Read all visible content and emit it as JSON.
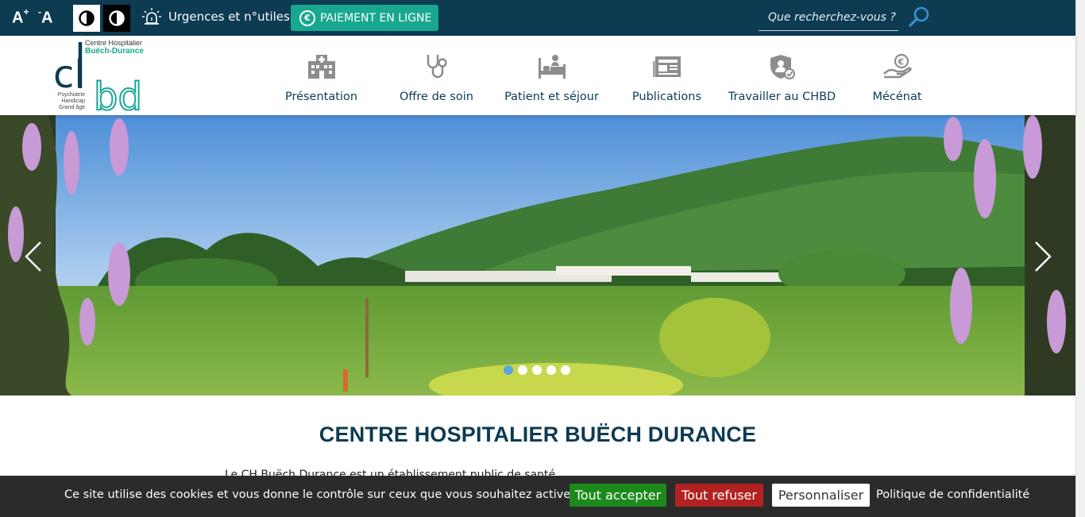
{
  "topbar": {
    "font_increase": "A",
    "font_increase_sup": "+",
    "font_decrease": "A",
    "font_decrease_sup": "-",
    "urgences_label": "Urgences et n°utiles",
    "pay_label": "PAIEMENT EN LIGNE",
    "pay_icon_glyph": "€",
    "search_placeholder": "Que recherchez-vous ?"
  },
  "logo": {
    "line1": "Centre Hospitalier",
    "line2": "Buëch-Durance",
    "tagline": [
      "Psychiatrie",
      "Handicap",
      "Grand âge"
    ],
    "letters_dark": "cl",
    "letters_light": "bd"
  },
  "nav": {
    "items": [
      {
        "label": "Présentation",
        "icon": "hospital-icon"
      },
      {
        "label": "Offre de soin",
        "icon": "stethoscope-icon"
      },
      {
        "label": "Patient et séjour",
        "icon": "bed-icon"
      },
      {
        "label": "Publications",
        "icon": "newspaper-icon"
      },
      {
        "label": "Travailler au CHBD",
        "icon": "shield-doctor-icon"
      },
      {
        "label": "Mécénat",
        "icon": "donation-hand-icon"
      }
    ]
  },
  "slider": {
    "slide_count": 5,
    "active_index": 0
  },
  "main": {
    "title": "CENTRE HOSPITALIER BUËCH DURANCE",
    "intro_partial": "Le CH Buëch Durance est un établissement public de santé"
  },
  "cookie": {
    "message": "Ce site utilise des cookies et vous donne le contrôle sur ceux que vous souhaitez activer",
    "accept_label": "Tout accepter",
    "refuse_label": "Tout refuser",
    "customize_label": "Personnaliser",
    "policy_label": "Politique de confidentialité"
  },
  "colors": {
    "topbar": "#0d3b52",
    "accent_teal": "#17a88f",
    "accept": "#1b8a1b",
    "refuse": "#b22222",
    "dot_active": "#5aa6d6"
  }
}
